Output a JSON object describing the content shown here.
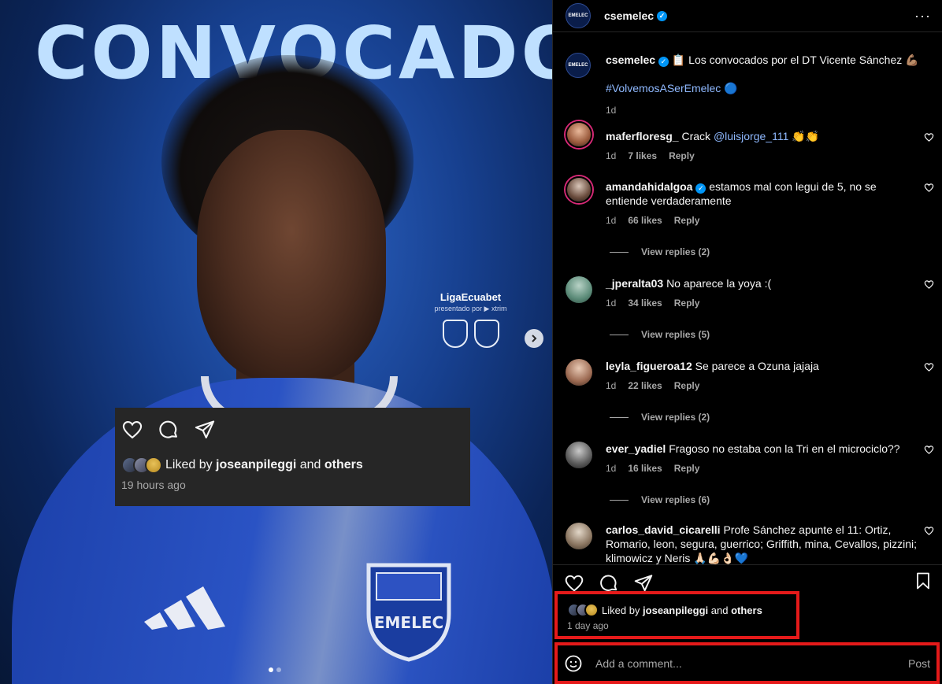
{
  "media": {
    "headline": "CONVOCADOS",
    "league_name": "LigaEcuabet",
    "league_sub": "presentado por ▶ xtrim",
    "crest_text": "EMELEC"
  },
  "overlay": {
    "liked_prefix": "Liked by",
    "liked_user": "joseanpileggi",
    "liked_and": "and",
    "liked_others": "others",
    "time": "19 hours ago"
  },
  "header": {
    "username": "csemelec",
    "avatar_text": "EMELEC"
  },
  "caption": {
    "username": "csemelec",
    "text": "📋 Los convocados por el DT Vicente Sánchez 💪🏽",
    "hashtag": "#VolvemosASerEmelec 🔵",
    "time": "1d"
  },
  "comments": [
    {
      "username": "maferfloresg_",
      "text": "Crack",
      "mention": "@luisjorge_111",
      "suffix": "👏👏",
      "time": "1d",
      "likes": "7 likes",
      "reply": "Reply",
      "verified": false,
      "view_replies": null
    },
    {
      "username": "amandahidalgoa",
      "text": "estamos mal con legui de 5, no se entiende verdaderamente",
      "mention": "",
      "suffix": "",
      "time": "1d",
      "likes": "66 likes",
      "reply": "Reply",
      "verified": true,
      "view_replies": "View replies (2)"
    },
    {
      "username": "_jperalta03",
      "text": "No aparece la yoya :(",
      "mention": "",
      "suffix": "",
      "time": "1d",
      "likes": "34 likes",
      "reply": "Reply",
      "verified": false,
      "view_replies": "View replies (5)"
    },
    {
      "username": "leyla_figueroa12",
      "text": "Se parece a Ozuna jajaja",
      "mention": "",
      "suffix": "",
      "time": "1d",
      "likes": "22 likes",
      "reply": "Reply",
      "verified": false,
      "view_replies": "View replies (2)"
    },
    {
      "username": "ever_yadiel",
      "text": "Fragoso no estaba con la Tri en el microciclo??",
      "mention": "",
      "suffix": "",
      "time": "1d",
      "likes": "16 likes",
      "reply": "Reply",
      "verified": false,
      "view_replies": "View replies (6)"
    },
    {
      "username": "carlos_david_cicarelli",
      "text": "Profe Sánchez apunte el 11: Ortiz, Romario, leon, segura, guerrico; Griffith, mina, Cevallos, pizzini; klimowicz y Neris 🙏🏻💪🏻👌🏻💙",
      "mention": "",
      "suffix": "",
      "time": "",
      "likes": "",
      "reply": "",
      "verified": false,
      "view_replies": null
    }
  ],
  "footer": {
    "liked_prefix": "Liked by",
    "liked_user": "joseanpileggi",
    "liked_and": "and",
    "liked_others": "others",
    "time": "1 day ago",
    "comment_placeholder": "Add a comment...",
    "post_label": "Post"
  },
  "colors": {
    "accent_link": "#8fb9ff",
    "highlight_border": "#e51a1a",
    "verified": "#0095f6"
  }
}
